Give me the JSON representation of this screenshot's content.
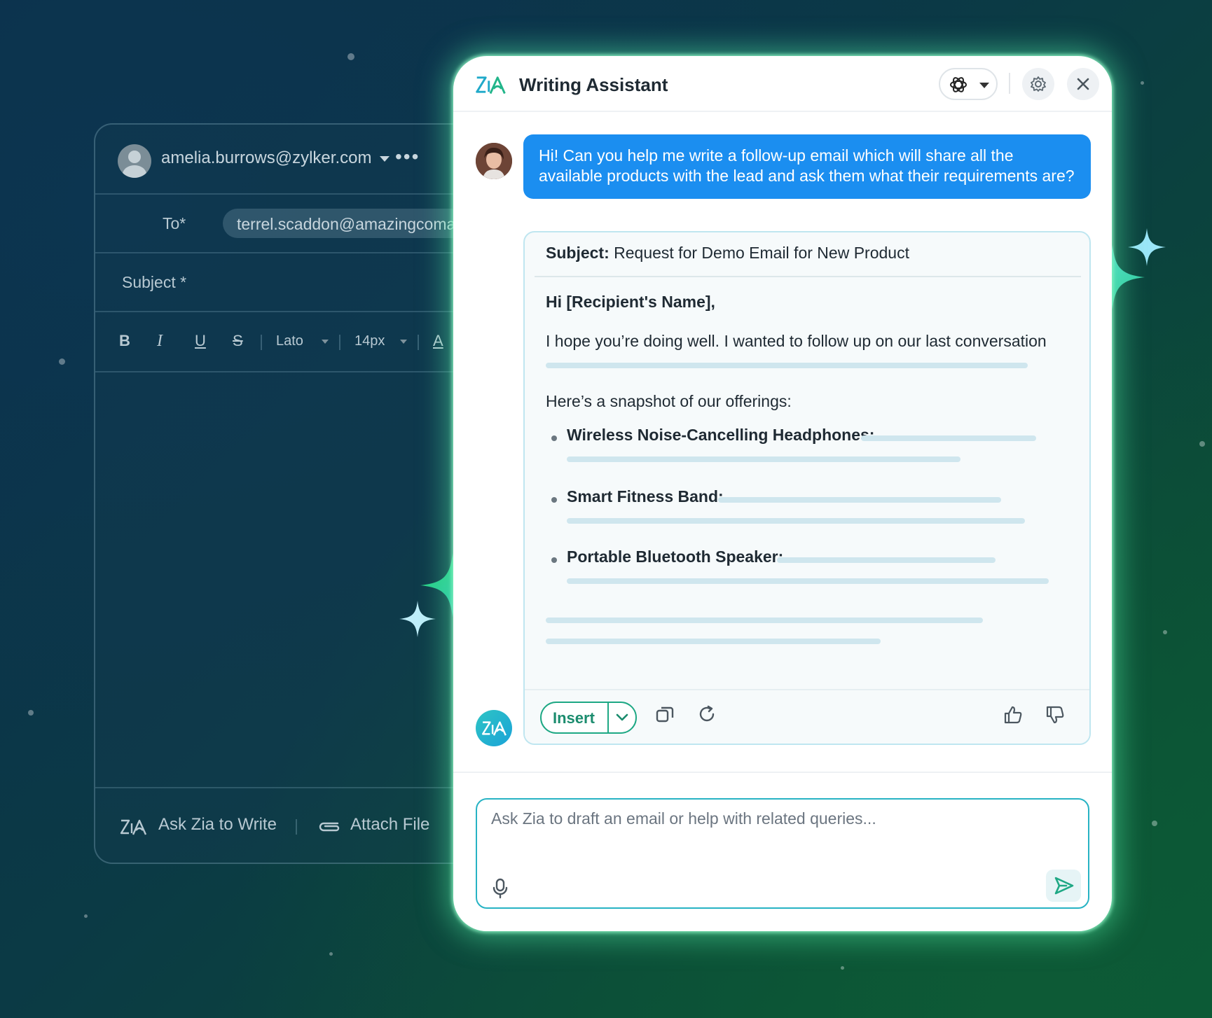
{
  "compose": {
    "from_email": "amelia.burrows@zylker.com",
    "to_label": "To*",
    "to_value": "terrel.scaddon@amazingcomapny.com",
    "subject_label": "Subject *",
    "toolbar": {
      "bold": "B",
      "italic": "I",
      "underline": "U",
      "strike": "S",
      "font": "Lato",
      "size": "14px",
      "color": "A"
    },
    "ask_zia": "Ask Zia to Write",
    "attach_file": "Attach File"
  },
  "assistant": {
    "title": "Writing Assistant",
    "user_message": "Hi! Can you help me write a follow-up email which will share all the available products with the lead and ask them what their requirements are?",
    "response": {
      "subject_label": "Subject:",
      "subject_text": "Request for Demo Email for New Product",
      "greeting": "Hi [Recipient's Name],",
      "intro": "I hope you’re doing well. I wanted to follow up on our last conversation",
      "snapshot": "Here’s a snapshot of our offerings:",
      "products": [
        "Wireless Noise-Cancelling Headphones:",
        "Smart Fitness Band:",
        "Portable Bluetooth Speaker:"
      ]
    },
    "insert_label": "Insert",
    "input_placeholder": "Ask Zia to draft an email or help with related queries..."
  },
  "colors": {
    "accent_blue": "#1b8ef0",
    "accent_green": "#1ea884",
    "glow": "#50e6a0"
  }
}
